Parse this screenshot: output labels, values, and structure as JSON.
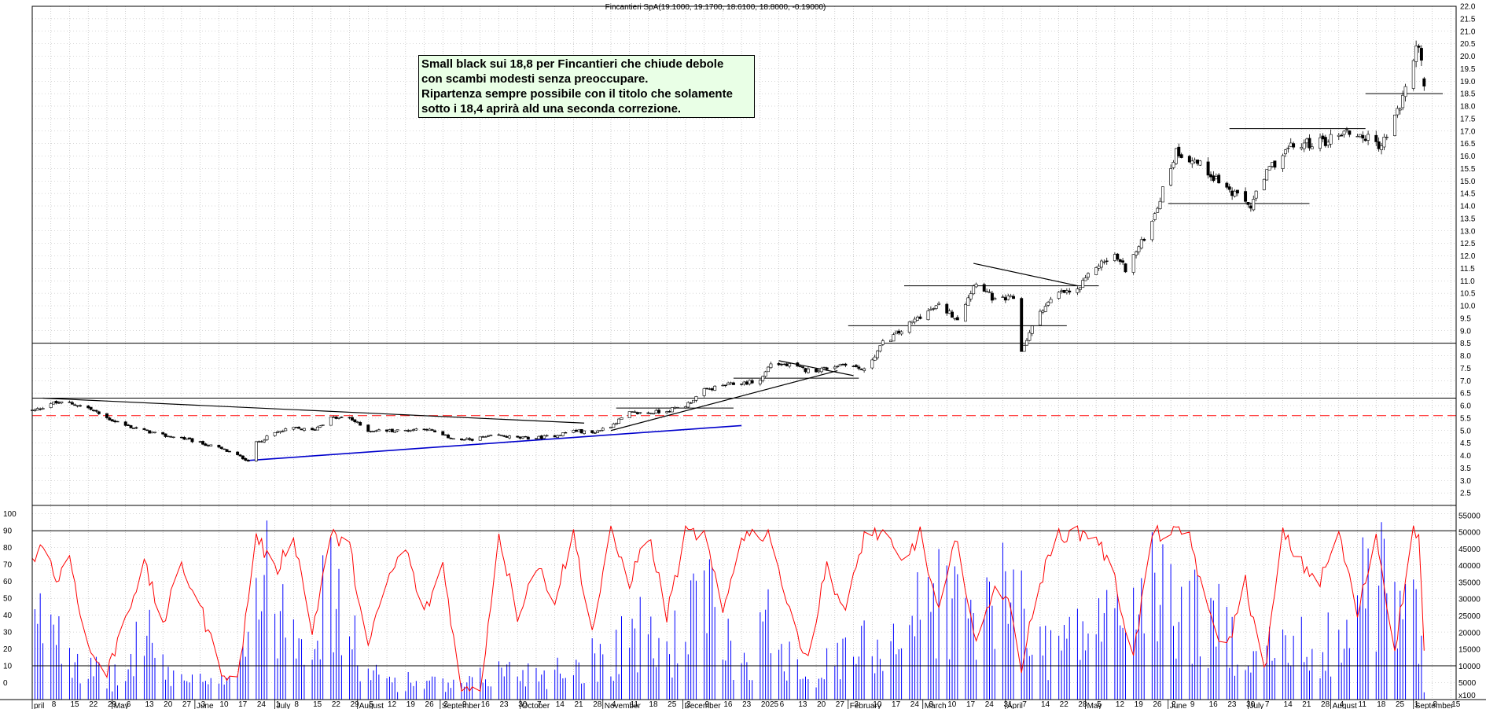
{
  "title": "Fincantieri SpA(19.1000, 19.1700, 18.6100, 18.8000, -0.19000)",
  "annotation": [
    "Small black sui 18,8 per Fincantieri che chiude debole",
    "con scambi modesti senza preoccupare.",
    "Ripartenza sempre possibile con il titolo che solamente",
    "sotto i 18,4 aprirà ald una seconda correzione."
  ],
  "volume_axis_unit": "x100",
  "chart_data": [
    {
      "type": "candlestick",
      "title": "Fincantieri SpA(19.1000, 19.1700, 18.6100, 18.8000, -0.19000)",
      "last_bar": {
        "open": 19.1,
        "high": 19.17,
        "low": 18.61,
        "close": 18.8,
        "change": -0.19
      },
      "ylim": [
        2.0,
        22.0
      ],
      "y_ticks": [
        2.5,
        3.0,
        3.5,
        4.0,
        4.5,
        5.0,
        5.5,
        6.0,
        6.5,
        7.0,
        7.5,
        8.0,
        8.5,
        9.0,
        9.5,
        10.0,
        10.5,
        11.0,
        11.5,
        12.0,
        12.5,
        13.0,
        13.5,
        14.0,
        14.5,
        15.0,
        15.5,
        16.0,
        16.5,
        17.0,
        17.5,
        18.0,
        18.5,
        19.0,
        19.5,
        20.0,
        20.5,
        21.0,
        21.5,
        22.0
      ],
      "x_week_labels": [
        "8",
        "15",
        "22",
        "29",
        "6",
        "13",
        "20",
        "27",
        "3",
        "10",
        "17",
        "24",
        "1",
        "8",
        "15",
        "22",
        "29",
        "5",
        "12",
        "19",
        "26",
        "2",
        "9",
        "16",
        "23",
        "30",
        "7",
        "14",
        "21",
        "28",
        "4",
        "11",
        "18",
        "25",
        "2",
        "9",
        "16",
        "23",
        "2025",
        "6",
        "13",
        "20",
        "27",
        "3",
        "10",
        "17",
        "24",
        "3",
        "10",
        "17",
        "24",
        "31",
        "7",
        "14",
        "22",
        "28",
        "5",
        "12",
        "19",
        "26",
        "2",
        "9",
        "16",
        "23",
        "30",
        "7",
        "14",
        "21",
        "28",
        "4",
        "11",
        "18",
        "25",
        "1",
        "8",
        "15"
      ],
      "x_month_labels": [
        "pril",
        "May",
        "June",
        "July",
        "August",
        "September",
        "October",
        "November",
        "December",
        "February",
        "March",
        "April",
        "May",
        "June",
        "July",
        "August",
        "September"
      ],
      "anchor_closes": [
        [
          "2024-04-02",
          5.8
        ],
        [
          "2024-04-08",
          6.1
        ],
        [
          "2024-04-15",
          6.1
        ],
        [
          "2024-04-22",
          5.9
        ],
        [
          "2024-04-29",
          5.5
        ],
        [
          "2024-05-06",
          5.2
        ],
        [
          "2024-05-13",
          5.0
        ],
        [
          "2024-05-20",
          4.8
        ],
        [
          "2024-05-27",
          4.7
        ],
        [
          "2024-06-03",
          4.5
        ],
        [
          "2024-06-10",
          4.3
        ],
        [
          "2024-06-17",
          4.0
        ],
        [
          "2024-06-21",
          3.8
        ],
        [
          "2024-06-24",
          4.5
        ],
        [
          "2024-07-01",
          4.9
        ],
        [
          "2024-07-08",
          5.1
        ],
        [
          "2024-07-15",
          5.0
        ],
        [
          "2024-07-22",
          5.5
        ],
        [
          "2024-07-29",
          5.5
        ],
        [
          "2024-08-05",
          5.0
        ],
        [
          "2024-08-12",
          5.0
        ],
        [
          "2024-08-19",
          5.0
        ],
        [
          "2024-08-26",
          5.1
        ],
        [
          "2024-09-02",
          4.8
        ],
        [
          "2024-09-09",
          4.6
        ],
        [
          "2024-09-16",
          4.7
        ],
        [
          "2024-09-23",
          4.8
        ],
        [
          "2024-09-30",
          4.7
        ],
        [
          "2024-10-07",
          4.7
        ],
        [
          "2024-10-14",
          4.8
        ],
        [
          "2024-10-21",
          5.0
        ],
        [
          "2024-10-28",
          4.9
        ],
        [
          "2024-11-04",
          5.2
        ],
        [
          "2024-11-11",
          5.7
        ],
        [
          "2024-11-18",
          5.7
        ],
        [
          "2024-11-25",
          5.8
        ],
        [
          "2024-12-02",
          6.0
        ],
        [
          "2024-12-09",
          6.6
        ],
        [
          "2024-12-16",
          6.8
        ],
        [
          "2024-12-23",
          6.9
        ],
        [
          "2024-12-30",
          7.0
        ],
        [
          "2025-01-03",
          7.7
        ],
        [
          "2025-01-10",
          7.6
        ],
        [
          "2025-01-17",
          7.4
        ],
        [
          "2025-01-24",
          7.5
        ],
        [
          "2025-01-31",
          7.7
        ],
        [
          "2025-02-07",
          7.4
        ],
        [
          "2025-02-14",
          8.5
        ],
        [
          "2025-02-21",
          9.0
        ],
        [
          "2025-02-28",
          9.6
        ],
        [
          "2025-03-07",
          10.0
        ],
        [
          "2025-03-14",
          9.5
        ],
        [
          "2025-03-21",
          11.0
        ],
        [
          "2025-03-28",
          10.2
        ],
        [
          "2025-04-04",
          10.3
        ],
        [
          "2025-04-07",
          8.2
        ],
        [
          "2025-04-14",
          9.8
        ],
        [
          "2025-04-21",
          10.5
        ],
        [
          "2025-04-28",
          10.6
        ],
        [
          "2025-05-05",
          11.6
        ],
        [
          "2025-05-12",
          12.0
        ],
        [
          "2025-05-16",
          11.5
        ],
        [
          "2025-05-22",
          12.5
        ],
        [
          "2025-05-28",
          14.0
        ],
        [
          "2025-06-04",
          16.2
        ],
        [
          "2025-06-11",
          15.8
        ],
        [
          "2025-06-18",
          15.2
        ],
        [
          "2025-06-25",
          14.5
        ],
        [
          "2025-07-02",
          14.0
        ],
        [
          "2025-07-09",
          15.5
        ],
        [
          "2025-07-16",
          16.3
        ],
        [
          "2025-07-23",
          16.5
        ],
        [
          "2025-07-30",
          16.6
        ],
        [
          "2025-08-06",
          17.0
        ],
        [
          "2025-08-13",
          16.8
        ],
        [
          "2025-08-20",
          16.4
        ],
        [
          "2025-08-27",
          18.0
        ],
        [
          "2025-09-03",
          20.6
        ],
        [
          "2025-09-05",
          18.8
        ]
      ],
      "horizontal_levels": [
        {
          "y": 8.5,
          "style": "solid",
          "color": "#000000"
        },
        {
          "y": 6.3,
          "style": "solid",
          "color": "#000000"
        },
        {
          "y": 5.6,
          "style": "dashed",
          "color": "#ff0000"
        }
      ],
      "trend_lines": [
        {
          "color": "#000000",
          "from": [
            "2024-04-05",
            6.3
          ],
          "to": [
            "2024-10-25",
            5.3
          ]
        },
        {
          "color": "#0000cc",
          "from": [
            "2024-06-21",
            3.8
          ],
          "to": [
            "2024-12-23",
            5.2
          ]
        },
        {
          "color": "#000000",
          "from": [
            "2024-11-04",
            5.0
          ],
          "to": [
            "2025-01-28",
            7.4
          ]
        },
        {
          "color": "#000000",
          "from": [
            "2025-01-06",
            7.8
          ],
          "to": [
            "2025-02-03",
            7.2
          ]
        },
        {
          "color": "#000000",
          "from": [
            "2025-03-20",
            11.7
          ],
          "to": [
            "2025-04-28",
            10.8
          ]
        }
      ],
      "level_segments": [
        {
          "y": 7.1,
          "from": "2024-12-20",
          "to": "2025-02-05"
        },
        {
          "y": 5.9,
          "from": "2024-11-06",
          "to": "2024-12-20"
        },
        {
          "y": 9.2,
          "from": "2025-02-01",
          "to": "2025-04-24"
        },
        {
          "y": 10.8,
          "from": "2025-02-22",
          "to": "2025-05-06"
        },
        {
          "y": 14.1,
          "from": "2025-06-01",
          "to": "2025-07-24"
        },
        {
          "y": 17.1,
          "from": "2025-06-24",
          "to": "2025-08-14"
        },
        {
          "y": 18.5,
          "from": "2025-08-14",
          "to": "2025-09-12"
        }
      ]
    },
    {
      "type": "line",
      "series": [
        {
          "color": "#ff0000"
        }
      ],
      "ylim": [
        -10,
        105
      ],
      "y_ticks": [
        0,
        10,
        20,
        30,
        40,
        50,
        60,
        70,
        80,
        90,
        100
      ],
      "reference_levels": [
        10,
        90
      ],
      "oscillator_anchors": [
        [
          "2024-04-01",
          70
        ],
        [
          "2024-04-05",
          85
        ],
        [
          "2024-04-10",
          60
        ],
        [
          "2024-04-15",
          75
        ],
        [
          "2024-04-22",
          20
        ],
        [
          "2024-04-29",
          5
        ],
        [
          "2024-05-06",
          40
        ],
        [
          "2024-05-13",
          70
        ],
        [
          "2024-05-20",
          35
        ],
        [
          "2024-05-27",
          70
        ],
        [
          "2024-06-03",
          45
        ],
        [
          "2024-06-10",
          10
        ],
        [
          "2024-06-17",
          0
        ],
        [
          "2024-06-24",
          88
        ],
        [
          "2024-07-01",
          65
        ],
        [
          "2024-07-08",
          88
        ],
        [
          "2024-07-15",
          30
        ],
        [
          "2024-07-22",
          88
        ],
        [
          "2024-07-29",
          80
        ],
        [
          "2024-08-05",
          20
        ],
        [
          "2024-08-12",
          60
        ],
        [
          "2024-08-19",
          80
        ],
        [
          "2024-08-26",
          40
        ],
        [
          "2024-09-02",
          70
        ],
        [
          "2024-09-09",
          -5
        ],
        [
          "2024-09-16",
          -5
        ],
        [
          "2024-09-23",
          88
        ],
        [
          "2024-09-30",
          40
        ],
        [
          "2024-10-07",
          70
        ],
        [
          "2024-10-14",
          50
        ],
        [
          "2024-10-21",
          88
        ],
        [
          "2024-10-28",
          30
        ],
        [
          "2024-11-04",
          88
        ],
        [
          "2024-11-11",
          60
        ],
        [
          "2024-11-18",
          88
        ],
        [
          "2024-11-25",
          40
        ],
        [
          "2024-12-02",
          88
        ],
        [
          "2024-12-09",
          88
        ],
        [
          "2024-12-16",
          40
        ],
        [
          "2024-12-23",
          88
        ],
        [
          "2024-12-30",
          88
        ],
        [
          "2025-01-03",
          88
        ],
        [
          "2025-01-10",
          40
        ],
        [
          "2025-01-17",
          15
        ],
        [
          "2025-01-24",
          70
        ],
        [
          "2025-01-31",
          40
        ],
        [
          "2025-02-07",
          88
        ],
        [
          "2025-02-14",
          88
        ],
        [
          "2025-02-21",
          70
        ],
        [
          "2025-02-28",
          88
        ],
        [
          "2025-03-07",
          40
        ],
        [
          "2025-03-14",
          88
        ],
        [
          "2025-03-21",
          20
        ],
        [
          "2025-03-28",
          60
        ],
        [
          "2025-04-04",
          40
        ],
        [
          "2025-04-07",
          10
        ],
        [
          "2025-04-14",
          60
        ],
        [
          "2025-04-21",
          88
        ],
        [
          "2025-04-28",
          88
        ],
        [
          "2025-05-05",
          88
        ],
        [
          "2025-05-12",
          60
        ],
        [
          "2025-05-19",
          15
        ],
        [
          "2025-05-26",
          88
        ],
        [
          "2025-06-02",
          88
        ],
        [
          "2025-06-09",
          88
        ],
        [
          "2025-06-16",
          40
        ],
        [
          "2025-06-23",
          20
        ],
        [
          "2025-06-30",
          60
        ],
        [
          "2025-07-07",
          5
        ],
        [
          "2025-07-14",
          88
        ],
        [
          "2025-07-21",
          70
        ],
        [
          "2025-07-28",
          60
        ],
        [
          "2025-08-04",
          88
        ],
        [
          "2025-08-11",
          40
        ],
        [
          "2025-08-18",
          88
        ],
        [
          "2025-08-25",
          20
        ],
        [
          "2025-09-01",
          92
        ],
        [
          "2025-09-03",
          88
        ],
        [
          "2025-09-05",
          20
        ]
      ]
    },
    {
      "type": "bar",
      "series": [
        {
          "color": "#0000ff"
        }
      ],
      "ylim": [
        0,
        58000
      ],
      "y_ticks": [
        5000,
        10000,
        15000,
        20000,
        25000,
        30000,
        35000,
        40000,
        45000,
        50000,
        55000
      ],
      "unit": "x100",
      "volume_anchors": [
        [
          "2024-04-01",
          25000
        ],
        [
          "2024-04-08",
          40000
        ],
        [
          "2024-04-22",
          12000
        ],
        [
          "2024-05-06",
          8000
        ],
        [
          "2024-05-13",
          35000
        ],
        [
          "2024-05-20",
          12000
        ],
        [
          "2024-06-10",
          5000
        ],
        [
          "2024-06-21",
          30000
        ],
        [
          "2024-06-24",
          50000
        ],
        [
          "2024-07-01",
          45000
        ],
        [
          "2024-07-15",
          32000
        ],
        [
          "2024-07-22",
          45000
        ],
        [
          "2024-08-05",
          10000
        ],
        [
          "2024-09-09",
          5000
        ],
        [
          "2024-09-23",
          12000
        ],
        [
          "2024-10-14",
          12000
        ],
        [
          "2024-11-04",
          20000
        ],
        [
          "2024-11-11",
          30000
        ],
        [
          "2024-11-25",
          20000
        ],
        [
          "2024-12-09",
          42000
        ],
        [
          "2024-12-23",
          15000
        ],
        [
          "2025-01-03",
          32000
        ],
        [
          "2025-01-17",
          10000
        ],
        [
          "2025-02-07",
          22000
        ],
        [
          "2025-02-21",
          30000
        ],
        [
          "2025-03-07",
          45000
        ],
        [
          "2025-03-21",
          33000
        ],
        [
          "2025-04-07",
          47000
        ],
        [
          "2025-04-14",
          22000
        ],
        [
          "2025-05-05",
          30000
        ],
        [
          "2025-05-19",
          42000
        ],
        [
          "2025-05-26",
          45000
        ],
        [
          "2025-06-09",
          38000
        ],
        [
          "2025-06-23",
          28000
        ],
        [
          "2025-07-07",
          20000
        ],
        [
          "2025-07-21",
          22000
        ],
        [
          "2025-08-04",
          26000
        ],
        [
          "2025-08-18",
          54000
        ],
        [
          "2025-08-25",
          38000
        ],
        [
          "2025-09-03",
          33000
        ],
        [
          "2025-09-05",
          8000
        ]
      ]
    }
  ],
  "colors": {
    "candle": "#000000",
    "grid": "#b0b0b0",
    "oscillator": "#ff0000",
    "volume": "#0000ff",
    "support_line": "#0000cc",
    "dashed_level": "#ff0000",
    "annotation_bg": "#e9ffe6"
  }
}
